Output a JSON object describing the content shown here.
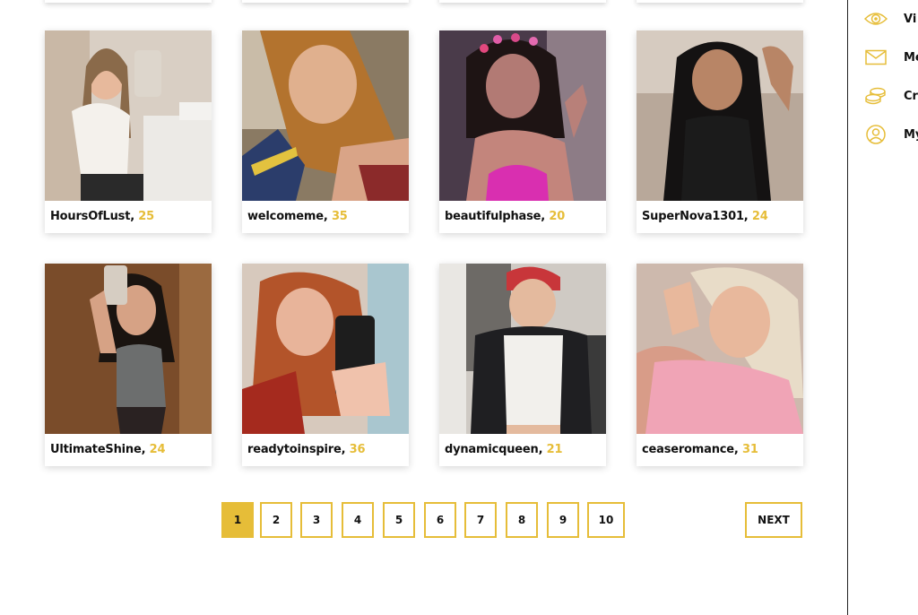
{
  "colors": {
    "accent": "#e6bd38",
    "text": "#111111"
  },
  "profiles": [
    {
      "name": "HoursOfLust",
      "age": "25"
    },
    {
      "name": "welcomeme",
      "age": "35"
    },
    {
      "name": "beautifulphase",
      "age": "20"
    },
    {
      "name": "SuperNova1301",
      "age": "24"
    },
    {
      "name": "UltimateShine",
      "age": "24"
    },
    {
      "name": "readytoinspire",
      "age": "36"
    },
    {
      "name": "dynamicqueen",
      "age": "21"
    },
    {
      "name": "ceaseromance",
      "age": "31"
    }
  ],
  "pagination": {
    "pages": [
      "1",
      "2",
      "3",
      "4",
      "5",
      "6",
      "7",
      "8",
      "9",
      "10"
    ],
    "current": "1",
    "next_label": "NEXT"
  },
  "sidebar": {
    "items": [
      {
        "label": "Vi",
        "icon": "eye-icon"
      },
      {
        "label": "Me",
        "icon": "envelope-icon"
      },
      {
        "label": "Cr",
        "icon": "coins-icon"
      },
      {
        "label": "My",
        "icon": "user-circle-icon"
      }
    ]
  }
}
